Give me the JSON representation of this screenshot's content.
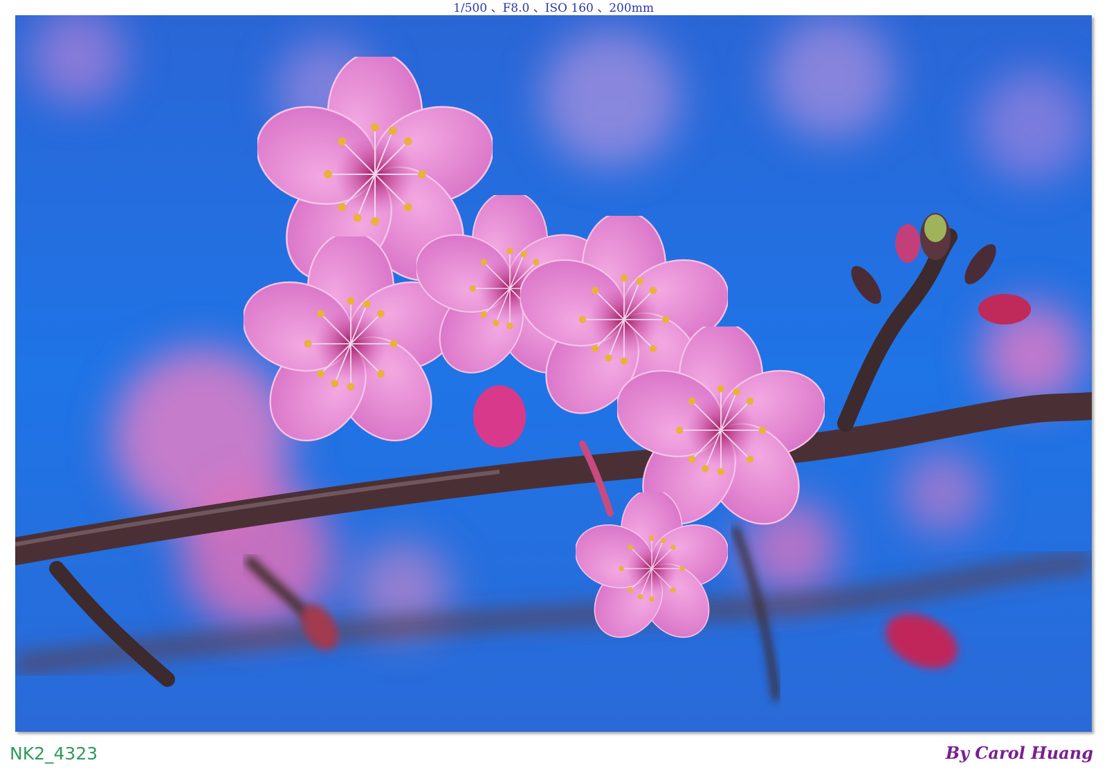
{
  "exif_caption": "1/500 、F8.0 、ISO 160 、200mm",
  "file_id": "NK2_4323",
  "credit": "By Carol Huang",
  "photo": {
    "subject": "pink cherry blossoms on a branch",
    "sky_color": "#1f6fe0",
    "petal_color": "#e889d0",
    "branch_color": "#4a3035",
    "stamen_color": "#e9b23a"
  }
}
